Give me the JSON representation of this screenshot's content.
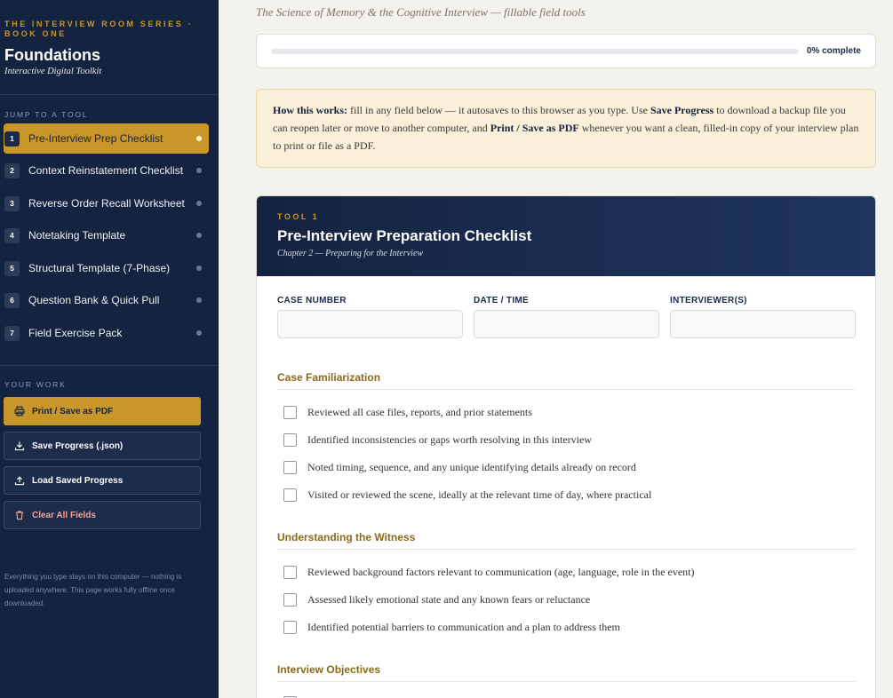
{
  "sidebar": {
    "series": "The Interview Room Series · Book One",
    "title": "Foundations",
    "subtitle": "Interactive Digital Toolkit",
    "jump_label": "Jump to a tool",
    "nav": [
      {
        "num": "1",
        "label": "Pre-Interview Prep Checklist",
        "active": true
      },
      {
        "num": "2",
        "label": "Context Reinstatement Checklist",
        "active": false
      },
      {
        "num": "3",
        "label": "Reverse Order Recall Worksheet",
        "active": false
      },
      {
        "num": "4",
        "label": "Notetaking Template",
        "active": false
      },
      {
        "num": "5",
        "label": "Structural Template (7-Phase)",
        "active": false
      },
      {
        "num": "6",
        "label": "Question Bank & Quick Pull",
        "active": false
      },
      {
        "num": "7",
        "label": "Field Exercise Pack",
        "active": false
      }
    ],
    "work_label": "Your work",
    "actions": {
      "print": "Print / Save as PDF",
      "save": "Save Progress (.json)",
      "load": "Load Saved Progress",
      "clear": "Clear All Fields"
    },
    "footnote": "Everything you type stays on this computer — nothing is uploaded anywhere. This page works fully offline once downloaded."
  },
  "main": {
    "breadcrumb": "The Science of Memory & the Cognitive Interview — fillable field tools",
    "progress": {
      "percent": 0,
      "text": "0% complete"
    },
    "notice": {
      "lead": "How this works:",
      "t1": " fill in any field below — it autosaves to this browser as you type. Use ",
      "b1": "Save Progress",
      "t2": " to download a backup file you can reopen later or move to another computer, and ",
      "b2": "Print / Save as PDF",
      "t3": " whenever you want a clean, filled-in copy of your interview plan to print or file as a PDF."
    },
    "tool": {
      "kicker": "TOOL 1",
      "title": "Pre-Interview Preparation Checklist",
      "subtitle": "Chapter 2 — Preparing for the Interview",
      "fields": [
        {
          "label": "CASE NUMBER",
          "value": ""
        },
        {
          "label": "DATE / TIME",
          "value": ""
        },
        {
          "label": "INTERVIEWER(S)",
          "value": ""
        }
      ],
      "groups": [
        {
          "title": "Case Familiarization",
          "items": [
            "Reviewed all case files, reports, and prior statements",
            "Identified inconsistencies or gaps worth resolving in this interview",
            "Noted timing, sequence, and any unique identifying details already on record",
            "Visited or reviewed the scene, ideally at the relevant time of day, where practical"
          ]
        },
        {
          "title": "Understanding the Witness",
          "items": [
            "Reviewed background factors relevant to communication (age, language, role in the event)",
            "Assessed likely emotional state and any known fears or reluctance",
            "Identified potential barriers to communication and a plan to address them"
          ]
        },
        {
          "title": "Interview Objectives",
          "items": []
        }
      ]
    }
  }
}
